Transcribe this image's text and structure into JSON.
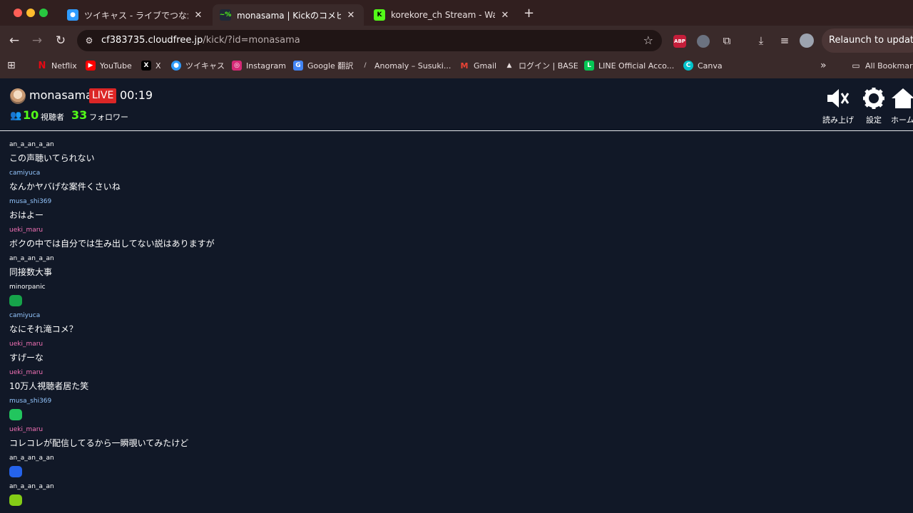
{
  "browser": {
    "tabs": [
      {
        "title": "ツイキャス - ライブでつながるコ",
        "favicon": "twitcasting-icon"
      },
      {
        "title": "monasama | Kickのコメビュ",
        "favicon": "terminal-icon"
      },
      {
        "title": "korekore_ch Stream - Watch",
        "favicon": "kick-icon"
      }
    ],
    "url_host": "cf383735.cloudfree.jp",
    "url_path": "/kick/?id=monasama",
    "relaunch_label": "Relaunch to update",
    "extensions": [
      {
        "name": "abp-icon",
        "label": "ABP",
        "color": "#c41e3a"
      },
      {
        "name": "extension-badge-icon",
        "label": "",
        "color": "#6b7280"
      }
    ],
    "bookmarks": [
      {
        "label": "Netflix",
        "icon": "N",
        "color": "#e50914"
      },
      {
        "label": "YouTube",
        "icon": "▶",
        "color": "#ff0000"
      },
      {
        "label": "X",
        "icon": "X",
        "color": "#000000"
      },
      {
        "label": "ツイキャス",
        "icon": "●",
        "color": "#2f9cff"
      },
      {
        "label": "Instagram",
        "icon": "◎",
        "color": "#d62976"
      },
      {
        "label": "Google 翻訳",
        "icon": "G",
        "color": "#4285f4"
      },
      {
        "label": "Anomaly – Susuki...",
        "icon": "/",
        "color": "#3a2a2a"
      },
      {
        "label": "Gmail",
        "icon": "M",
        "color": "#ea4335"
      },
      {
        "label": "ログイン | BASE",
        "icon": "▲",
        "color": "#3a2a2a"
      },
      {
        "label": "LINE Official Acco...",
        "icon": "L",
        "color": "#06c755"
      },
      {
        "label": "Canva",
        "icon": "C",
        "color": "#00c4cc"
      }
    ],
    "all_bookmarks_label": "All Bookmarks"
  },
  "header": {
    "streamer": "monasama",
    "live_label": "LIVE",
    "elapsed": "00:19",
    "viewers_count": "10",
    "viewers_label": "視聴者",
    "followers_count": "33",
    "followers_label": "フォロワー",
    "buttons": [
      {
        "label": "読み上げ",
        "icon": "speaker-mute-icon"
      },
      {
        "label": "設定",
        "icon": "gear-icon"
      },
      {
        "label": "ホーム",
        "icon": "home-icon"
      }
    ]
  },
  "chat": {
    "messages": [
      {
        "user": "an_a_an_a_an",
        "user_color": "#ffffff",
        "text": "この声聴いてられない",
        "emote": ""
      },
      {
        "user": "camiyuca",
        "user_color": "#93c5fd",
        "text": "なんかヤバげな案件くさいね",
        "emote": ""
      },
      {
        "user": "musa_shi369",
        "user_color": "#93c5fd",
        "text": "おはよー",
        "emote": ""
      },
      {
        "user": "ueki_maru",
        "user_color": "#f472b6",
        "text": "ボクの中では自分では生み出してない説はありますが",
        "emote": ""
      },
      {
        "user": "an_a_an_a_an",
        "user_color": "#ffffff",
        "text": "同接数大事",
        "emote": ""
      },
      {
        "user": "minorpanic",
        "user_color": "#ffffff",
        "text": "",
        "emote": "#16a34a"
      },
      {
        "user": "camiyuca",
        "user_color": "#93c5fd",
        "text": "なにそれ滝コメ？",
        "emote": ""
      },
      {
        "user": "ueki_maru",
        "user_color": "#f472b6",
        "text": "すげーな",
        "emote": ""
      },
      {
        "user": "ueki_maru",
        "user_color": "#f472b6",
        "text": "10万人視聴者居た笑",
        "emote": ""
      },
      {
        "user": "musa_shi369",
        "user_color": "#93c5fd",
        "text": "",
        "emote": "#22c55e"
      },
      {
        "user": "ueki_maru",
        "user_color": "#f472b6",
        "text": "コレコレが配信してるから一瞬覗いてみたけど",
        "emote": ""
      },
      {
        "user": "an_a_an_a_an",
        "user_color": "#ffffff",
        "text": "",
        "emote": "#2563eb"
      },
      {
        "user": "an_a_an_a_an",
        "user_color": "#ffffff",
        "text": "",
        "emote": "#84cc16"
      }
    ]
  }
}
